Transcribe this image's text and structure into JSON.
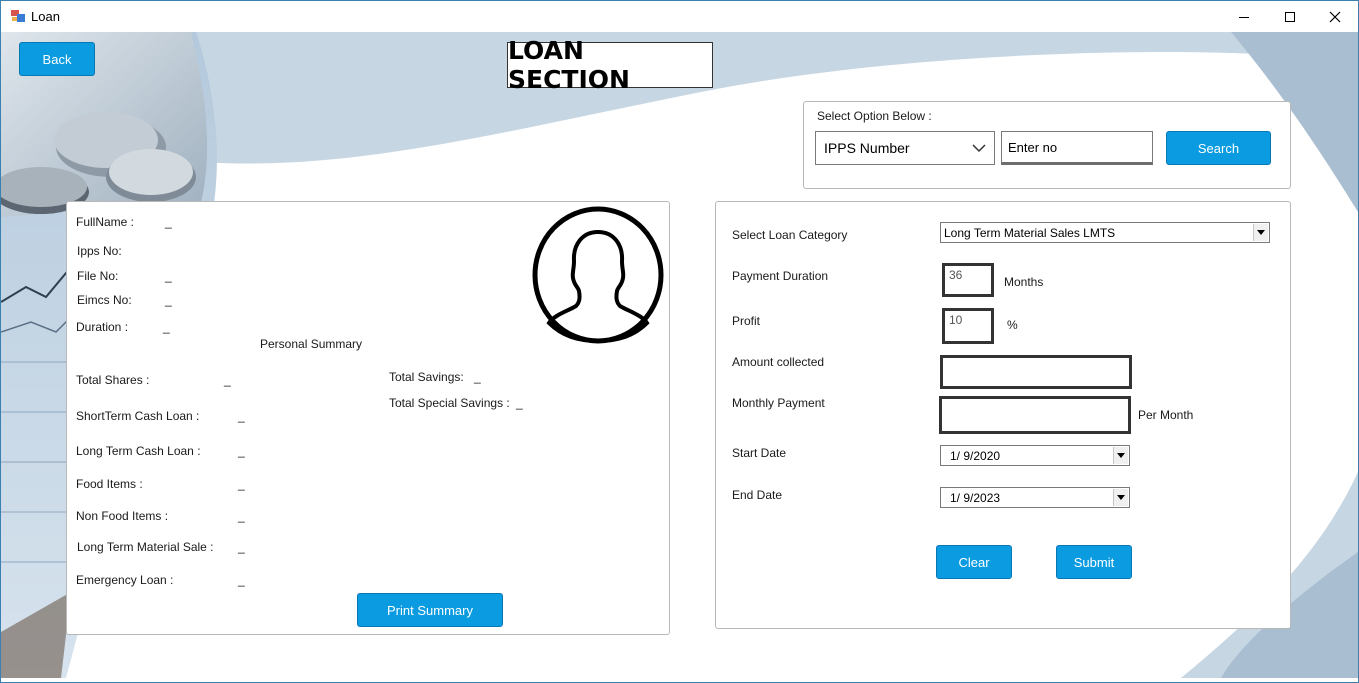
{
  "window": {
    "title": "Loan",
    "controls": {
      "minimize": "minimize-icon",
      "maximize": "maximize-icon",
      "close": "close-icon"
    }
  },
  "colors": {
    "accent": "#0a9be0",
    "bg_shape": "#c6d6e3",
    "border": "#333333"
  },
  "header": {
    "back_label": "Back",
    "title": "LOAN SECTION"
  },
  "search": {
    "prompt": "Select  Option Below :",
    "option_value": "IPPS Number",
    "input_value": "Enter  no",
    "search_label": "Search"
  },
  "profile": {
    "avatar_icon": "user-avatar-icon",
    "fields": {
      "fullname_label": "FullName :",
      "fullname_value": "_",
      "ipps_label": "Ipps No:",
      "ipps_value": "",
      "file_label": "File No:",
      "file_value": "_",
      "eimcs_label": "Eimcs No:",
      "eimcs_value": "_",
      "duration_label": "Duration :",
      "duration_value": "_"
    },
    "summary_title": "Personal Summary",
    "summary": {
      "total_shares_label": "Total Shares :",
      "total_shares_value": "_",
      "total_savings_label": "Total Savings:",
      "total_savings_value": "_",
      "total_special_label": "Total Special Savings :",
      "total_special_value": "_",
      "short_term_label": "ShortTerm Cash Loan  :",
      "short_term_value": "_",
      "long_term_label": "Long Term Cash Loan :",
      "long_term_value": "_",
      "food_label": "Food Items  :",
      "food_value": "_",
      "non_food_label": "Non Food Items  :",
      "non_food_value": "_",
      "ltms_label": "Long Term Material Sale :",
      "ltms_value": "_",
      "emergency_label": "Emergency Loan :",
      "emergency_value": "_"
    },
    "print_label": "Print Summary"
  },
  "loan_form": {
    "category_label": "Select Loan Category",
    "category_value": "Long Term Material Sales LMTS",
    "duration_label": "Payment Duration",
    "duration_value": "36",
    "duration_unit": "Months",
    "profit_label": "Profit",
    "profit_value": "10",
    "profit_unit": "%",
    "amount_label": "Amount collected",
    "amount_value": "",
    "monthly_label": "Monthly Payment",
    "monthly_value": "",
    "monthly_unit": "Per Month",
    "start_label": "Start Date",
    "start_value": "1/  9/2020",
    "end_label": "End Date",
    "end_value": "1/  9/2023",
    "clear_label": "Clear",
    "submit_label": "Submit"
  }
}
